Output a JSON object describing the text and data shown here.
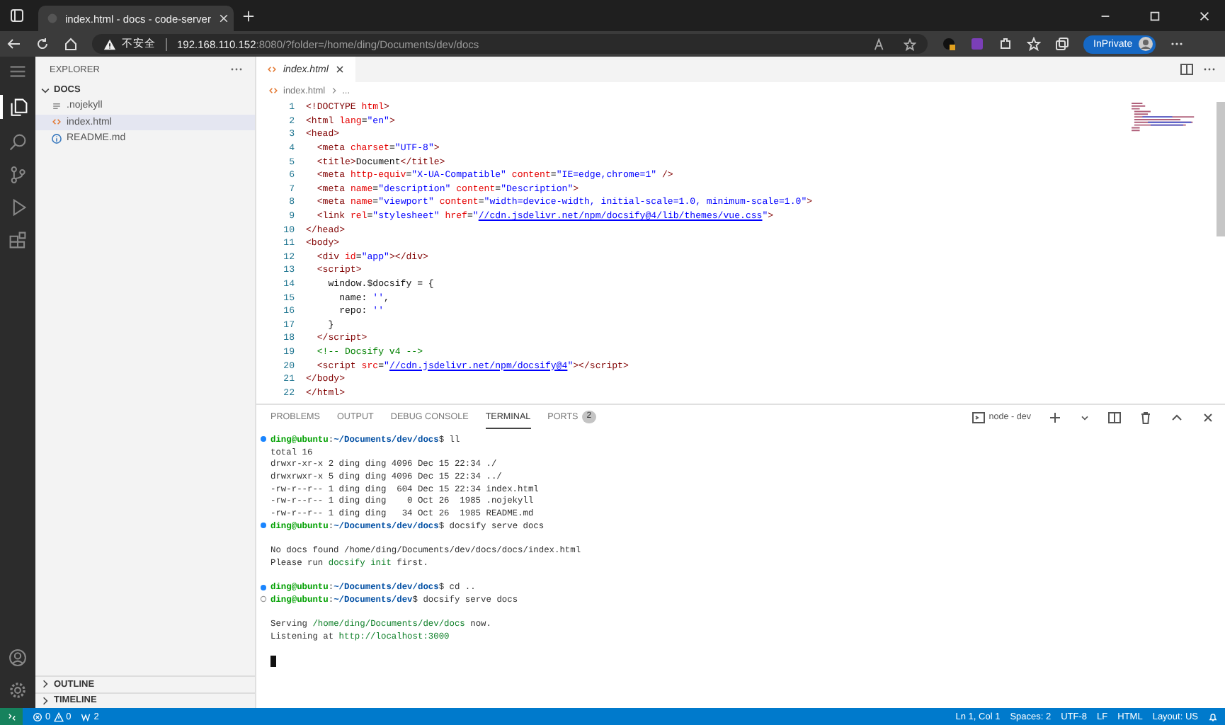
{
  "browser": {
    "tab_title": "index.html - docs - code-server",
    "address": {
      "security_label": "不安全",
      "host": "192.168.110.152",
      "rest": ":8080/?folder=/home/ding/Documents/dev/docs"
    },
    "inprivate_label": "InPrivate"
  },
  "sidebar": {
    "title": "EXPLORER",
    "folder": {
      "label": "DOCS",
      "expanded": true
    },
    "files": [
      {
        "name": ".nojekyll",
        "kind": "text",
        "selected": false
      },
      {
        "name": "index.html",
        "kind": "html",
        "selected": true
      },
      {
        "name": "README.md",
        "kind": "info",
        "selected": false
      }
    ],
    "sections": [
      {
        "label": "OUTLINE",
        "expanded": false
      },
      {
        "label": "TIMELINE",
        "expanded": false
      }
    ]
  },
  "editor": {
    "tabs": [
      {
        "label": "index.html",
        "selected": true,
        "preview": true
      }
    ],
    "breadcrumb": [
      "index.html",
      "..."
    ],
    "lines": [
      {
        "number": "1",
        "tokens": [
          {
            "kind": "tag",
            "text": "<!DOCTYPE "
          },
          {
            "kind": "attr",
            "text": "html"
          },
          {
            "kind": "tag",
            "text": ">"
          }
        ]
      },
      {
        "number": "2",
        "tokens": [
          {
            "kind": "tag",
            "text": "<html"
          },
          {
            "kind": "attr",
            "text": " lang"
          },
          {
            "kind": "text",
            "text": "="
          },
          {
            "kind": "string",
            "text": "\"en\""
          },
          {
            "kind": "tag",
            "text": ">"
          }
        ]
      },
      {
        "number": "3",
        "tokens": [
          {
            "kind": "tag",
            "text": "<head>"
          }
        ]
      },
      {
        "number": "4",
        "tokens": [
          {
            "kind": "tag",
            "text": "  <meta"
          },
          {
            "kind": "attr",
            "text": " charset"
          },
          {
            "kind": "text",
            "text": "="
          },
          {
            "kind": "string",
            "text": "\"UTF-8\""
          },
          {
            "kind": "tag",
            "text": ">"
          }
        ]
      },
      {
        "number": "5",
        "tokens": [
          {
            "kind": "tag",
            "text": "  <title>"
          },
          {
            "kind": "text",
            "text": "Document"
          },
          {
            "kind": "tag",
            "text": "</title>"
          }
        ]
      },
      {
        "number": "6",
        "tokens": [
          {
            "kind": "tag",
            "text": "  <meta"
          },
          {
            "kind": "attr",
            "text": " http-equiv"
          },
          {
            "kind": "text",
            "text": "="
          },
          {
            "kind": "string",
            "text": "\"X-UA-Compatible\""
          },
          {
            "kind": "attr",
            "text": " content"
          },
          {
            "kind": "text",
            "text": "="
          },
          {
            "kind": "string",
            "text": "\"IE=edge,chrome=1\""
          },
          {
            "kind": "tag",
            "text": " />"
          }
        ]
      },
      {
        "number": "7",
        "tokens": [
          {
            "kind": "tag",
            "text": "  <meta"
          },
          {
            "kind": "attr",
            "text": " name"
          },
          {
            "kind": "text",
            "text": "="
          },
          {
            "kind": "string",
            "text": "\"description\""
          },
          {
            "kind": "attr",
            "text": " content"
          },
          {
            "kind": "text",
            "text": "="
          },
          {
            "kind": "string",
            "text": "\"Description\""
          },
          {
            "kind": "tag",
            "text": ">"
          }
        ]
      },
      {
        "number": "8",
        "tokens": [
          {
            "kind": "tag",
            "text": "  <meta"
          },
          {
            "kind": "attr",
            "text": " name"
          },
          {
            "kind": "text",
            "text": "="
          },
          {
            "kind": "string",
            "text": "\"viewport\""
          },
          {
            "kind": "attr",
            "text": " content"
          },
          {
            "kind": "text",
            "text": "="
          },
          {
            "kind": "string",
            "text": "\"width=device-width, initial-scale=1.0, minimum-scale=1.0\""
          },
          {
            "kind": "tag",
            "text": ">"
          }
        ]
      },
      {
        "number": "9",
        "tokens": [
          {
            "kind": "tag",
            "text": "  <link"
          },
          {
            "kind": "attr",
            "text": " rel"
          },
          {
            "kind": "text",
            "text": "="
          },
          {
            "kind": "string",
            "text": "\"stylesheet\""
          },
          {
            "kind": "attr",
            "text": " href"
          },
          {
            "kind": "text",
            "text": "="
          },
          {
            "kind": "string",
            "text": "\""
          },
          {
            "kind": "link",
            "text": "//cdn.jsdelivr.net/npm/docsify@4/lib/themes/vue.css"
          },
          {
            "kind": "string",
            "text": "\""
          },
          {
            "kind": "tag",
            "text": ">"
          }
        ]
      },
      {
        "number": "10",
        "tokens": [
          {
            "kind": "tag",
            "text": "</head>"
          }
        ]
      },
      {
        "number": "11",
        "tokens": [
          {
            "kind": "tag",
            "text": "<body>"
          }
        ]
      },
      {
        "number": "12",
        "tokens": [
          {
            "kind": "tag",
            "text": "  <div"
          },
          {
            "kind": "attr",
            "text": " id"
          },
          {
            "kind": "text",
            "text": "="
          },
          {
            "kind": "string",
            "text": "\"app\""
          },
          {
            "kind": "tag",
            "text": "></div>"
          }
        ]
      },
      {
        "number": "13",
        "tokens": [
          {
            "kind": "tag",
            "text": "  <script>"
          }
        ]
      },
      {
        "number": "14",
        "tokens": [
          {
            "kind": "text",
            "text": "    window.$docsify = {"
          }
        ]
      },
      {
        "number": "15",
        "tokens": [
          {
            "kind": "text",
            "text": "      name: "
          },
          {
            "kind": "string",
            "text": "''"
          },
          {
            "kind": "text",
            "text": ","
          }
        ]
      },
      {
        "number": "16",
        "tokens": [
          {
            "kind": "text",
            "text": "      repo: "
          },
          {
            "kind": "string",
            "text": "''"
          }
        ]
      },
      {
        "number": "17",
        "tokens": [
          {
            "kind": "text",
            "text": "    }"
          }
        ]
      },
      {
        "number": "18",
        "tokens": [
          {
            "kind": "tag",
            "text": "  </script>"
          }
        ]
      },
      {
        "number": "19",
        "tokens": [
          {
            "kind": "comment",
            "text": "  <!-- Docsify v4 -->"
          }
        ]
      },
      {
        "number": "20",
        "tokens": [
          {
            "kind": "tag",
            "text": "  <script"
          },
          {
            "kind": "attr",
            "text": " src"
          },
          {
            "kind": "text",
            "text": "="
          },
          {
            "kind": "string",
            "text": "\""
          },
          {
            "kind": "link",
            "text": "//cdn.jsdelivr.net/npm/docsify@4"
          },
          {
            "kind": "string",
            "text": "\""
          },
          {
            "kind": "tag",
            "text": "></script>"
          }
        ]
      },
      {
        "number": "21",
        "tokens": [
          {
            "kind": "tag",
            "text": "</body>"
          }
        ]
      },
      {
        "number": "22",
        "tokens": [
          {
            "kind": "tag",
            "text": "</html>"
          }
        ]
      }
    ]
  },
  "panel": {
    "tabs": [
      {
        "label": "PROBLEMS",
        "selected": false
      },
      {
        "label": "OUTPUT",
        "selected": false
      },
      {
        "label": "DEBUG CONSOLE",
        "selected": false
      },
      {
        "label": "TERMINAL",
        "selected": true
      },
      {
        "label": "PORTS",
        "selected": false,
        "badge": "2"
      }
    ],
    "terminal_name": "node - dev",
    "blocks": [
      {
        "lines": [
          {
            "kind": "command",
            "finished": true,
            "segments": [
              {
                "kind": "user",
                "text": "ding@ubuntu"
              },
              {
                "kind": "text",
                "text": ":"
              },
              {
                "kind": "path",
                "text": "~/Documents/dev/docs"
              },
              {
                "kind": "text",
                "text": "$ ll"
              }
            ]
          },
          {
            "segments": [
              {
                "kind": "text",
                "text": "total 16"
              }
            ]
          },
          {
            "segments": [
              {
                "kind": "text",
                "text": "drwxr-xr-x 2 ding ding 4096 Dec 15 22:34 ./"
              }
            ]
          },
          {
            "segments": [
              {
                "kind": "text",
                "text": "drwxrwxr-x 5 ding ding 4096 Dec 15 22:34 ../"
              }
            ]
          },
          {
            "segments": [
              {
                "kind": "text",
                "text": "-rw-r--r-- 1 ding ding  604 Dec 15 22:34 index.html"
              }
            ]
          },
          {
            "segments": [
              {
                "kind": "text",
                "text": "-rw-r--r-- 1 ding ding    0 Oct 26  1985 .nojekyll"
              }
            ]
          },
          {
            "segments": [
              {
                "kind": "text",
                "text": "-rw-r--r-- 1 ding ding   34 Oct 26  1985 README.md"
              }
            ]
          },
          {
            "kind": "command",
            "finished": true,
            "segments": [
              {
                "kind": "user",
                "text": "ding@ubuntu"
              },
              {
                "kind": "text",
                "text": ":"
              },
              {
                "kind": "path",
                "text": "~/Documents/dev/docs"
              },
              {
                "kind": "text",
                "text": "$ docsify serve docs"
              }
            ]
          }
        ]
      },
      {
        "lines": [
          {
            "segments": [
              {
                "kind": "text",
                "text": "No docs found /home/ding/Documents/dev/docs/docs/index.html"
              }
            ]
          },
          {
            "segments": [
              {
                "kind": "text",
                "text": "Please run "
              },
              {
                "kind": "green",
                "text": "docsify init"
              },
              {
                "kind": "text",
                "text": " first."
              }
            ]
          }
        ]
      },
      {
        "lines": [
          {
            "kind": "command",
            "finished": true,
            "segments": [
              {
                "kind": "user",
                "text": "ding@ubuntu"
              },
              {
                "kind": "text",
                "text": ":"
              },
              {
                "kind": "path",
                "text": "~/Documents/dev/docs"
              },
              {
                "kind": "text",
                "text": "$ cd .."
              }
            ]
          },
          {
            "kind": "command",
            "finished": false,
            "segments": [
              {
                "kind": "user",
                "text": "ding@ubuntu"
              },
              {
                "kind": "text",
                "text": ":"
              },
              {
                "kind": "path",
                "text": "~/Documents/dev"
              },
              {
                "kind": "text",
                "text": "$ docsify serve docs"
              }
            ]
          }
        ]
      },
      {
        "lines": [
          {
            "segments": [
              {
                "kind": "text",
                "text": "Serving "
              },
              {
                "kind": "green",
                "text": "/home/ding/Documents/dev/docs"
              },
              {
                "kind": "text",
                "text": " now."
              }
            ]
          },
          {
            "segments": [
              {
                "kind": "text",
                "text": "Listening at "
              },
              {
                "kind": "green",
                "text": "http://localhost:3000"
              }
            ]
          }
        ]
      }
    ]
  },
  "status_bar": {
    "errors": "0",
    "warnings": "0",
    "ports": "2",
    "items": [
      "Ln 1, Col 1",
      "Spaces: 2",
      "UTF-8",
      "LF",
      "HTML",
      "Layout: US"
    ]
  }
}
